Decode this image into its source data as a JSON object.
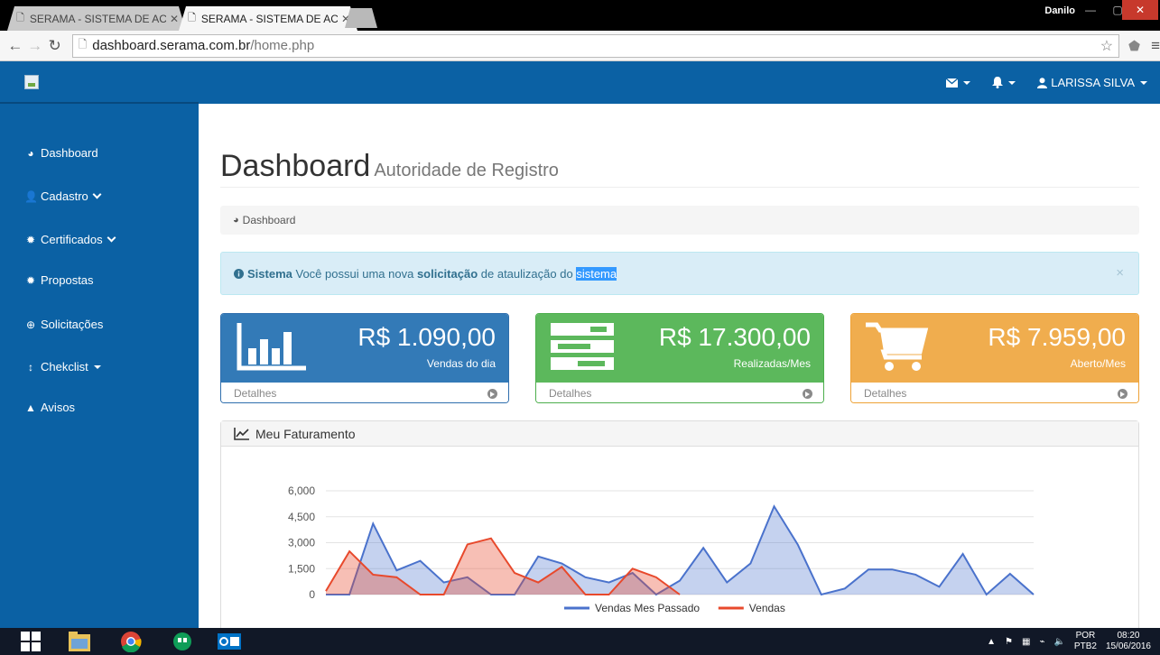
{
  "browser": {
    "tabs": [
      {
        "title": "SERAMA - SISTEMA DE AC",
        "active": false
      },
      {
        "title": "SERAMA - SISTEMA DE AC",
        "active": true
      }
    ],
    "window_user": "Danilo",
    "url_host": "dashboard.serama.com.br",
    "url_path": "/home.php"
  },
  "topnav": {
    "user_name": "LARISSA SILVA"
  },
  "sidebar": {
    "items": [
      {
        "label": "Dashboard",
        "icon": "tachometer-icon"
      },
      {
        "label": "Cadastro",
        "icon": "user-plus-icon"
      },
      {
        "label": "Certificados",
        "icon": "certificate-icon"
      },
      {
        "label": "Propostas",
        "icon": "certificate-icon"
      },
      {
        "label": "Solicitações",
        "icon": "life-ring-icon"
      },
      {
        "label": "Chekclist",
        "icon": "sort-icon"
      },
      {
        "label": "Avisos",
        "icon": "warning-icon"
      }
    ]
  },
  "header": {
    "title": "Dashboard",
    "subtitle": "Autoridade de Registro"
  },
  "breadcrumb": {
    "label": "Dashboard"
  },
  "alert": {
    "strong": "Sistema",
    "text1": "Você possui uma nova",
    "strong2": "solicitação",
    "text2": "de ataulização do",
    "highlight": "sistema",
    "close": "×"
  },
  "panels": [
    {
      "value": "R$ 1.090,00",
      "label": "Vendas do dia",
      "footer": "Detalhes",
      "color": "#337ab7",
      "icon": "bar-chart-icon"
    },
    {
      "value": "R$ 17.300,00",
      "label": "Realizadas/Mes",
      "footer": "Detalhes",
      "color": "#5cb85c",
      "icon": "tasks-icon"
    },
    {
      "value": "R$ 7.959,00",
      "label": "Aberto/Mes",
      "footer": "Detalhes",
      "color": "#f0ad4e",
      "icon": "shopping-cart-icon"
    }
  ],
  "chart_panel": {
    "title": "Meu Faturamento"
  },
  "chart_data": {
    "type": "area",
    "title": "",
    "ylim": [
      0,
      6000
    ],
    "yticks": [
      "6,000",
      "4,500",
      "3,000",
      "1,500",
      "0"
    ],
    "x": [
      0,
      1,
      2,
      3,
      4,
      5,
      6,
      7,
      8,
      9,
      10,
      11,
      12,
      13,
      14,
      15,
      16,
      17,
      18,
      19,
      20,
      21,
      22,
      23,
      24,
      25,
      26,
      27,
      28,
      29,
      30
    ],
    "series": [
      {
        "name": "Vendas Mes Passado",
        "color": "#4a72cc",
        "values": [
          0,
          0,
          4100,
          1400,
          1950,
          700,
          1000,
          0,
          0,
          2200,
          1800,
          1000,
          700,
          1250,
          0,
          800,
          2700,
          700,
          1800,
          5100,
          2900,
          0,
          350,
          1450,
          1450,
          1150,
          450,
          2350,
          0,
          1200,
          0
        ]
      },
      {
        "name": "Vendas",
        "color": "#e8492c",
        "values": [
          200,
          2500,
          1150,
          1000,
          0,
          0,
          2900,
          3250,
          1250,
          700,
          1600,
          0,
          0,
          1500,
          1000,
          0,
          null,
          null,
          null,
          null,
          null,
          null,
          null,
          null,
          null,
          null,
          null,
          null,
          null,
          null,
          null
        ]
      }
    ]
  },
  "taskbar": {
    "lang": "POR",
    "lang2": "PTB2",
    "time": "08:20",
    "date": "15/06/2016"
  }
}
